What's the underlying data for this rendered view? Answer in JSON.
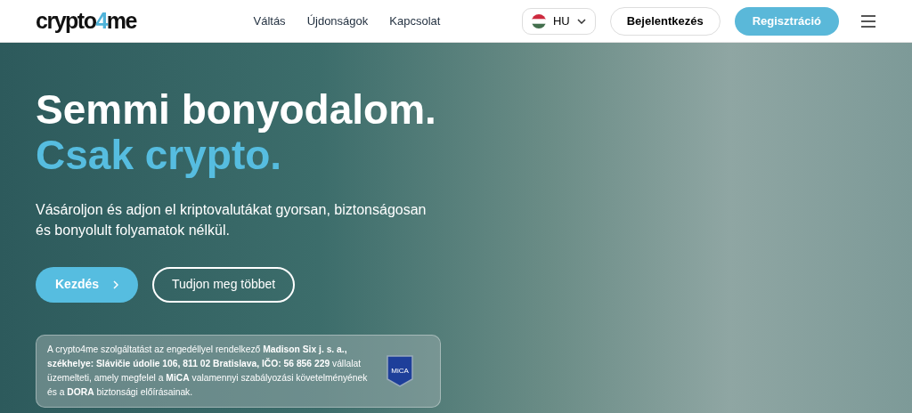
{
  "header": {
    "logo": {
      "before": "crypto",
      "accent": "4",
      "after": "me"
    },
    "nav": [
      {
        "label": "Váltás"
      },
      {
        "label": "Újdonságok"
      },
      {
        "label": "Kapcsolat"
      }
    ],
    "language": "HU",
    "login": "Bejelentkezés",
    "register": "Regisztráció"
  },
  "hero": {
    "title_line_1": "Semmi bonyodalom.",
    "title_line_2": "Csak crypto.",
    "subtitle": "Vásároljon és adjon el kriptovalutákat gyorsan, biztonságosan és bonyolult folyamatok nélkül.",
    "primary_button": "Kezdés",
    "secondary_button": "Tudjon meg többet",
    "notice": "A crypto4me szolgáltatást az engedéllyel rendelkező **Madison Six j. s. a., székhelye: Slávičie údolie 106, 811 02 Bratislava, IČO: 56 856 229** vállalat üzemelteti, amely megfelel a **MiCA** valamennyi szabályozási követelményének és a **DORA** biztonsági előírásainak.",
    "badge": "MiCA"
  }
}
